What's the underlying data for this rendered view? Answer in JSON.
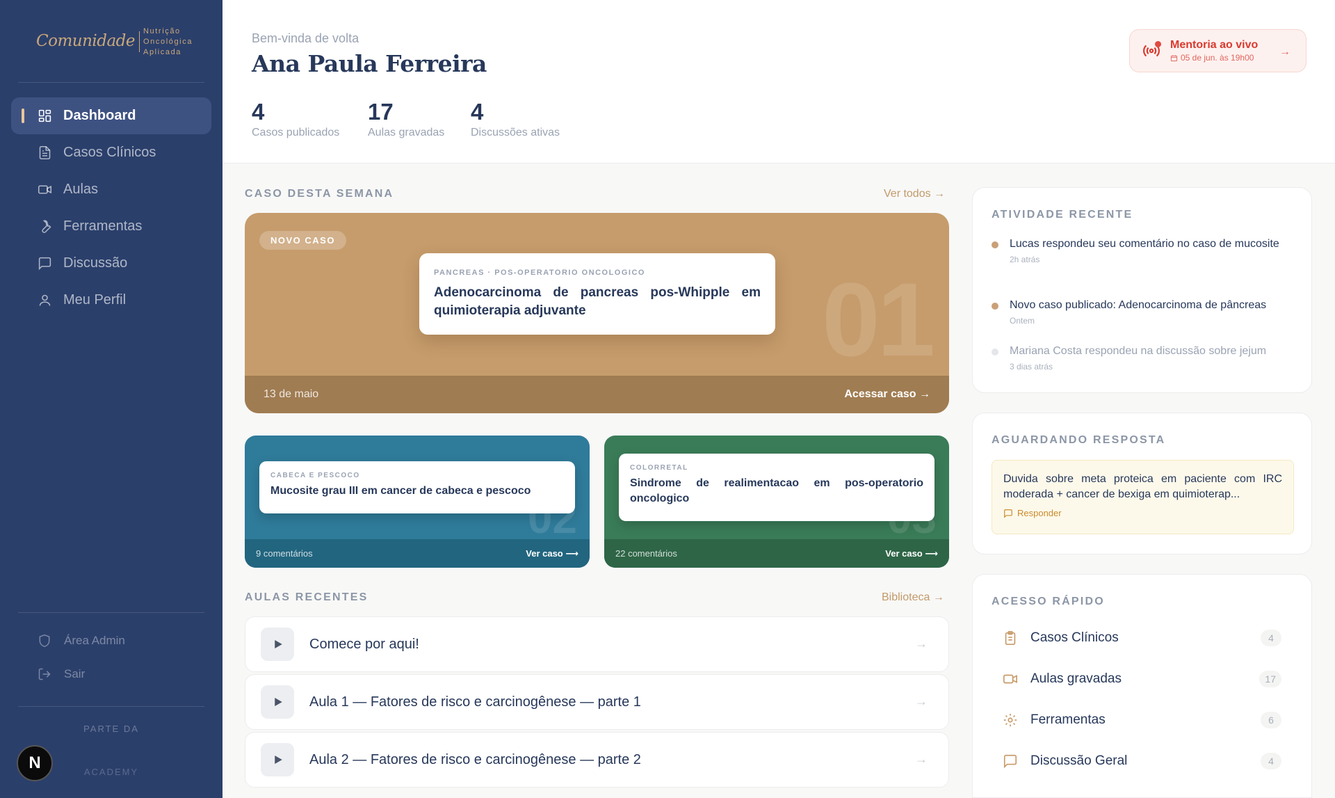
{
  "brand": {
    "logo_script": "Comunidade",
    "logo_lines": [
      "Nutrição",
      "Oncológica",
      "Aplicada"
    ]
  },
  "sidebar": {
    "items": [
      {
        "label": "Dashboard",
        "icon": "dashboard-grid-icon",
        "active": true
      },
      {
        "label": "Casos Clínicos",
        "icon": "document-icon"
      },
      {
        "label": "Aulas",
        "icon": "video-icon"
      },
      {
        "label": "Ferramentas",
        "icon": "wrench-icon"
      },
      {
        "label": "Discussão",
        "icon": "chat-icon"
      },
      {
        "label": "Meu Perfil",
        "icon": "user-icon"
      }
    ],
    "admin_label": "Área Admin",
    "logout_label": "Sair",
    "parte_da": "PARTE DA",
    "academy": "ACADEMY",
    "badge_letter": "N"
  },
  "header": {
    "welcome": "Bem-vinda de volta",
    "user_name": "Ana Paula Ferreira",
    "stats": [
      {
        "value": "4",
        "label": "Casos publicados"
      },
      {
        "value": "17",
        "label": "Aulas gravadas"
      },
      {
        "value": "4",
        "label": "Discussões ativas"
      }
    ],
    "mentoria": {
      "title": "Mentoria ao vivo",
      "date": "05 de jun. às 19h00",
      "arrow": "→"
    }
  },
  "cases": {
    "heading": "CASO DESTA SEMANA",
    "see_all": "Ver todos →",
    "featured": {
      "badge": "NOVO CASO",
      "number": "01",
      "tag": "PANCREAS · POS-OPERATORIO ONCOLOGICO",
      "title": "Adenocarcinoma de pancreas pos-Whipple em quimioterapia adjuvante",
      "date": "13 de maio",
      "action": "Acessar caso →",
      "color": "#c69c6c"
    },
    "small": [
      {
        "tag": "CABECA E PESCOCO",
        "title": "Mucosite grau III em cancer de cabeca e pescoco",
        "number": "02",
        "comments": "9 comentários",
        "action": "Ver caso ⟶",
        "color": "#2f7b9a",
        "footer_color": "#22657f"
      },
      {
        "tag": "COLORRETAL",
        "title": "Sindrome de realimentacao em pos-operatorio oncologico",
        "number": "03",
        "comments": "22 comentários",
        "action": "Ver caso ⟶",
        "color": "#3a7c58",
        "footer_color": "#2e6547"
      }
    ]
  },
  "lessons": {
    "heading": "AULAS RECENTES",
    "library": "Biblioteca →",
    "items": [
      {
        "title": "Comece por aqui!"
      },
      {
        "title": "Aula 1 — Fatores de risco e carcinogênese — parte 1"
      },
      {
        "title": "Aula 2 — Fatores de risco e carcinogênese — parte 2"
      }
    ]
  },
  "activity": {
    "heading": "ATIVIDADE RECENTE",
    "items": [
      {
        "text": "Lucas respondeu seu comentário no caso de mucosite",
        "time": "2h atrás",
        "dot": "#c9a077",
        "text_color": "#27385a"
      },
      {
        "text": "Novo caso publicado: Adenocarcinoma de pâncreas",
        "time": "Ontem",
        "dot": "#c9a077",
        "text_color": "#27385a"
      },
      {
        "text": "Mariana Costa respondeu na discussão sobre jejum",
        "time": "3 dias atrás",
        "dot": "#e4e6ea",
        "text_color": "#9aa3b3"
      }
    ]
  },
  "awaiting": {
    "heading": "AGUARDANDO RESPOSTA",
    "text": "Duvida sobre meta proteica em paciente com IRC moderada + cancer de bexiga em quimioterap...",
    "action": "Responder"
  },
  "quick_access": {
    "heading": "ACESSO RÁPIDO",
    "items": [
      {
        "label": "Casos Clínicos",
        "count": "4",
        "icon": "clipboard-icon"
      },
      {
        "label": "Aulas gravadas",
        "count": "17",
        "icon": "video-icon"
      },
      {
        "label": "Ferramentas",
        "count": "6",
        "icon": "gear-icon"
      },
      {
        "label": "Discussão Geral",
        "count": "4",
        "icon": "chat-icon"
      }
    ]
  }
}
